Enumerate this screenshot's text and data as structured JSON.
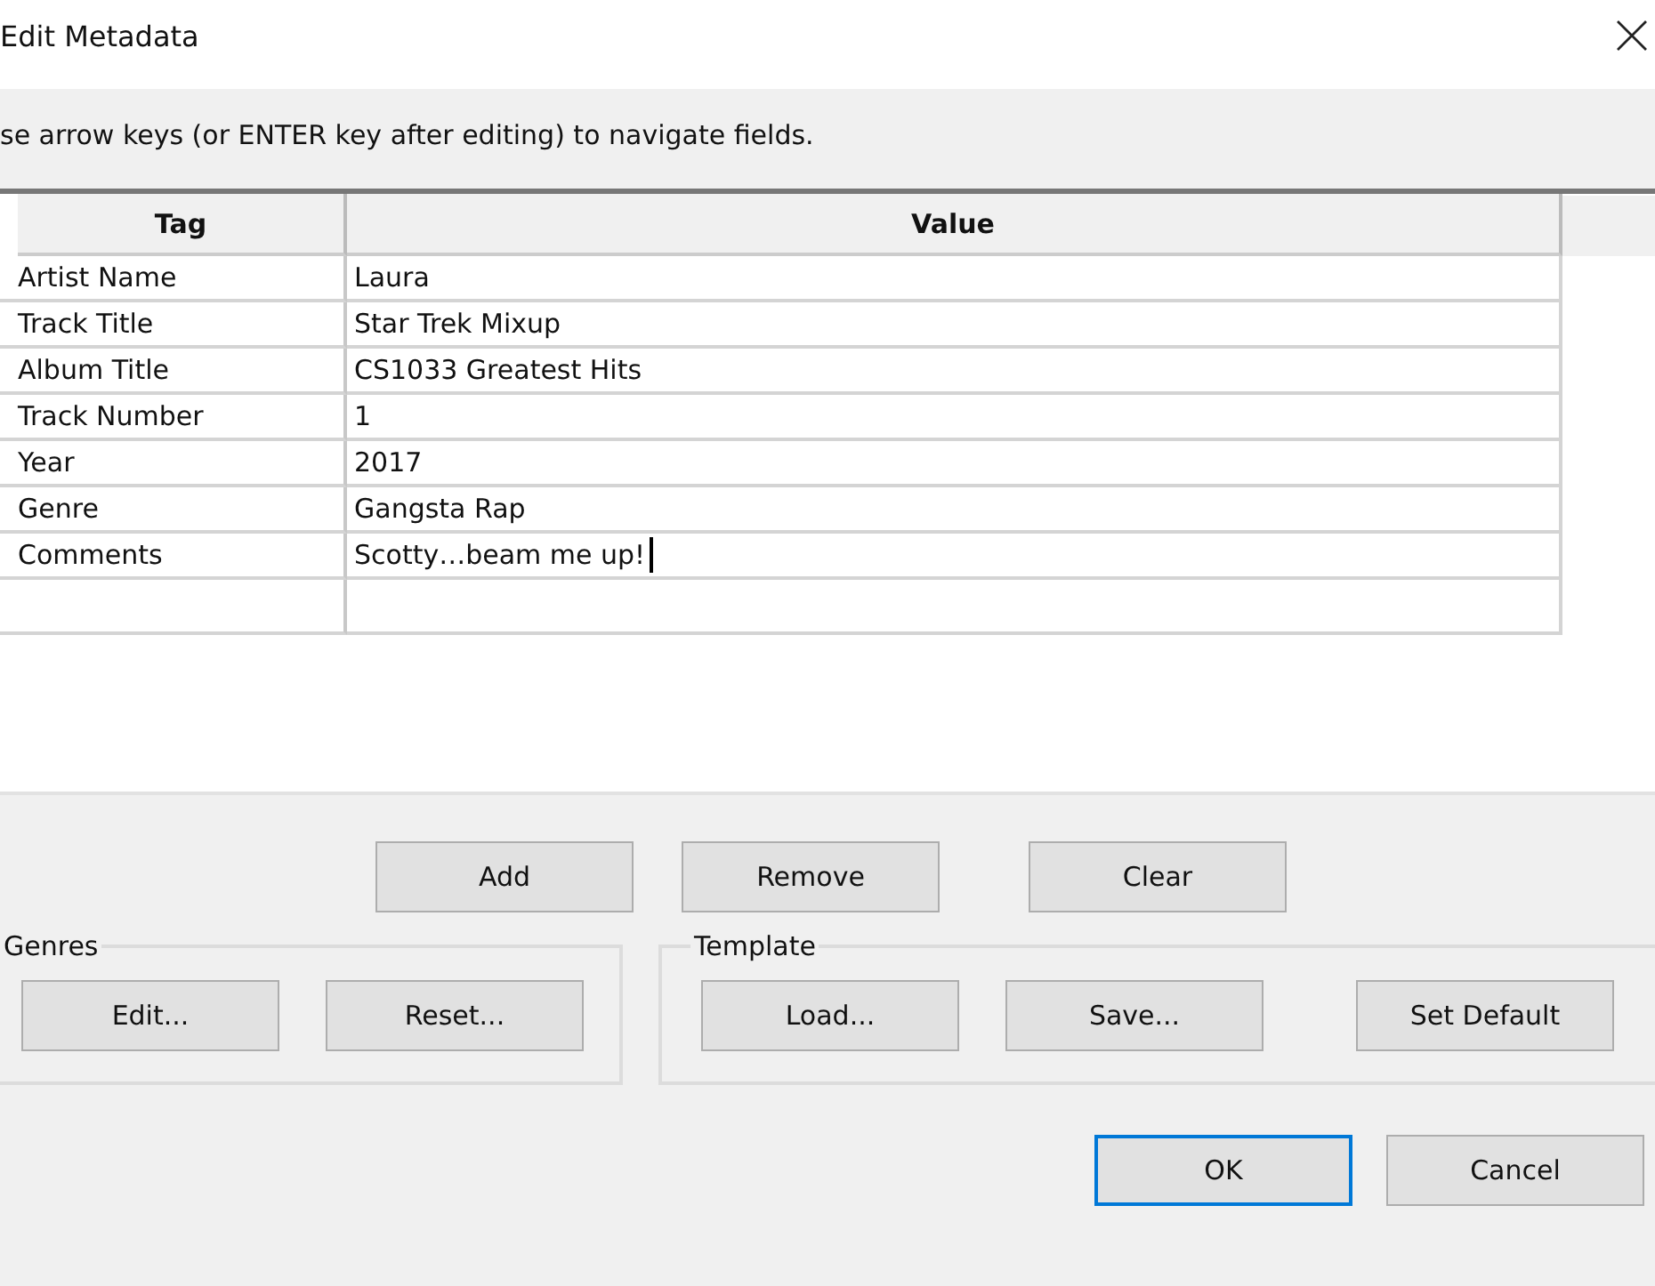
{
  "window": {
    "title": "Edit Metadata"
  },
  "instructions": "se arrow keys (or ENTER key after editing) to navigate fields.",
  "table": {
    "columns": [
      "Tag",
      "Value"
    ],
    "rows": [
      {
        "tag": "Artist Name",
        "value": "Laura",
        "editing": false
      },
      {
        "tag": "Track Title",
        "value": "Star Trek Mixup",
        "editing": false
      },
      {
        "tag": "Album Title",
        "value": "CS1033 Greatest Hits",
        "editing": false
      },
      {
        "tag": "Track Number",
        "value": "1",
        "editing": false
      },
      {
        "tag": "Year",
        "value": "2017",
        "editing": false
      },
      {
        "tag": "Genre",
        "value": "Gangsta Rap",
        "editing": false
      },
      {
        "tag": "Comments",
        "value": "Scotty…beam me up!",
        "editing": true
      }
    ]
  },
  "row_buttons": [
    "Add",
    "Remove",
    "Clear"
  ],
  "genres": {
    "title": "Genres",
    "buttons": [
      "Edit...",
      "Reset..."
    ]
  },
  "template": {
    "title": "Template",
    "buttons": [
      "Load...",
      "Save...",
      "Set Default"
    ]
  },
  "dialog_buttons": [
    {
      "label": "OK",
      "default": true
    },
    {
      "label": "Cancel",
      "default": false
    }
  ]
}
